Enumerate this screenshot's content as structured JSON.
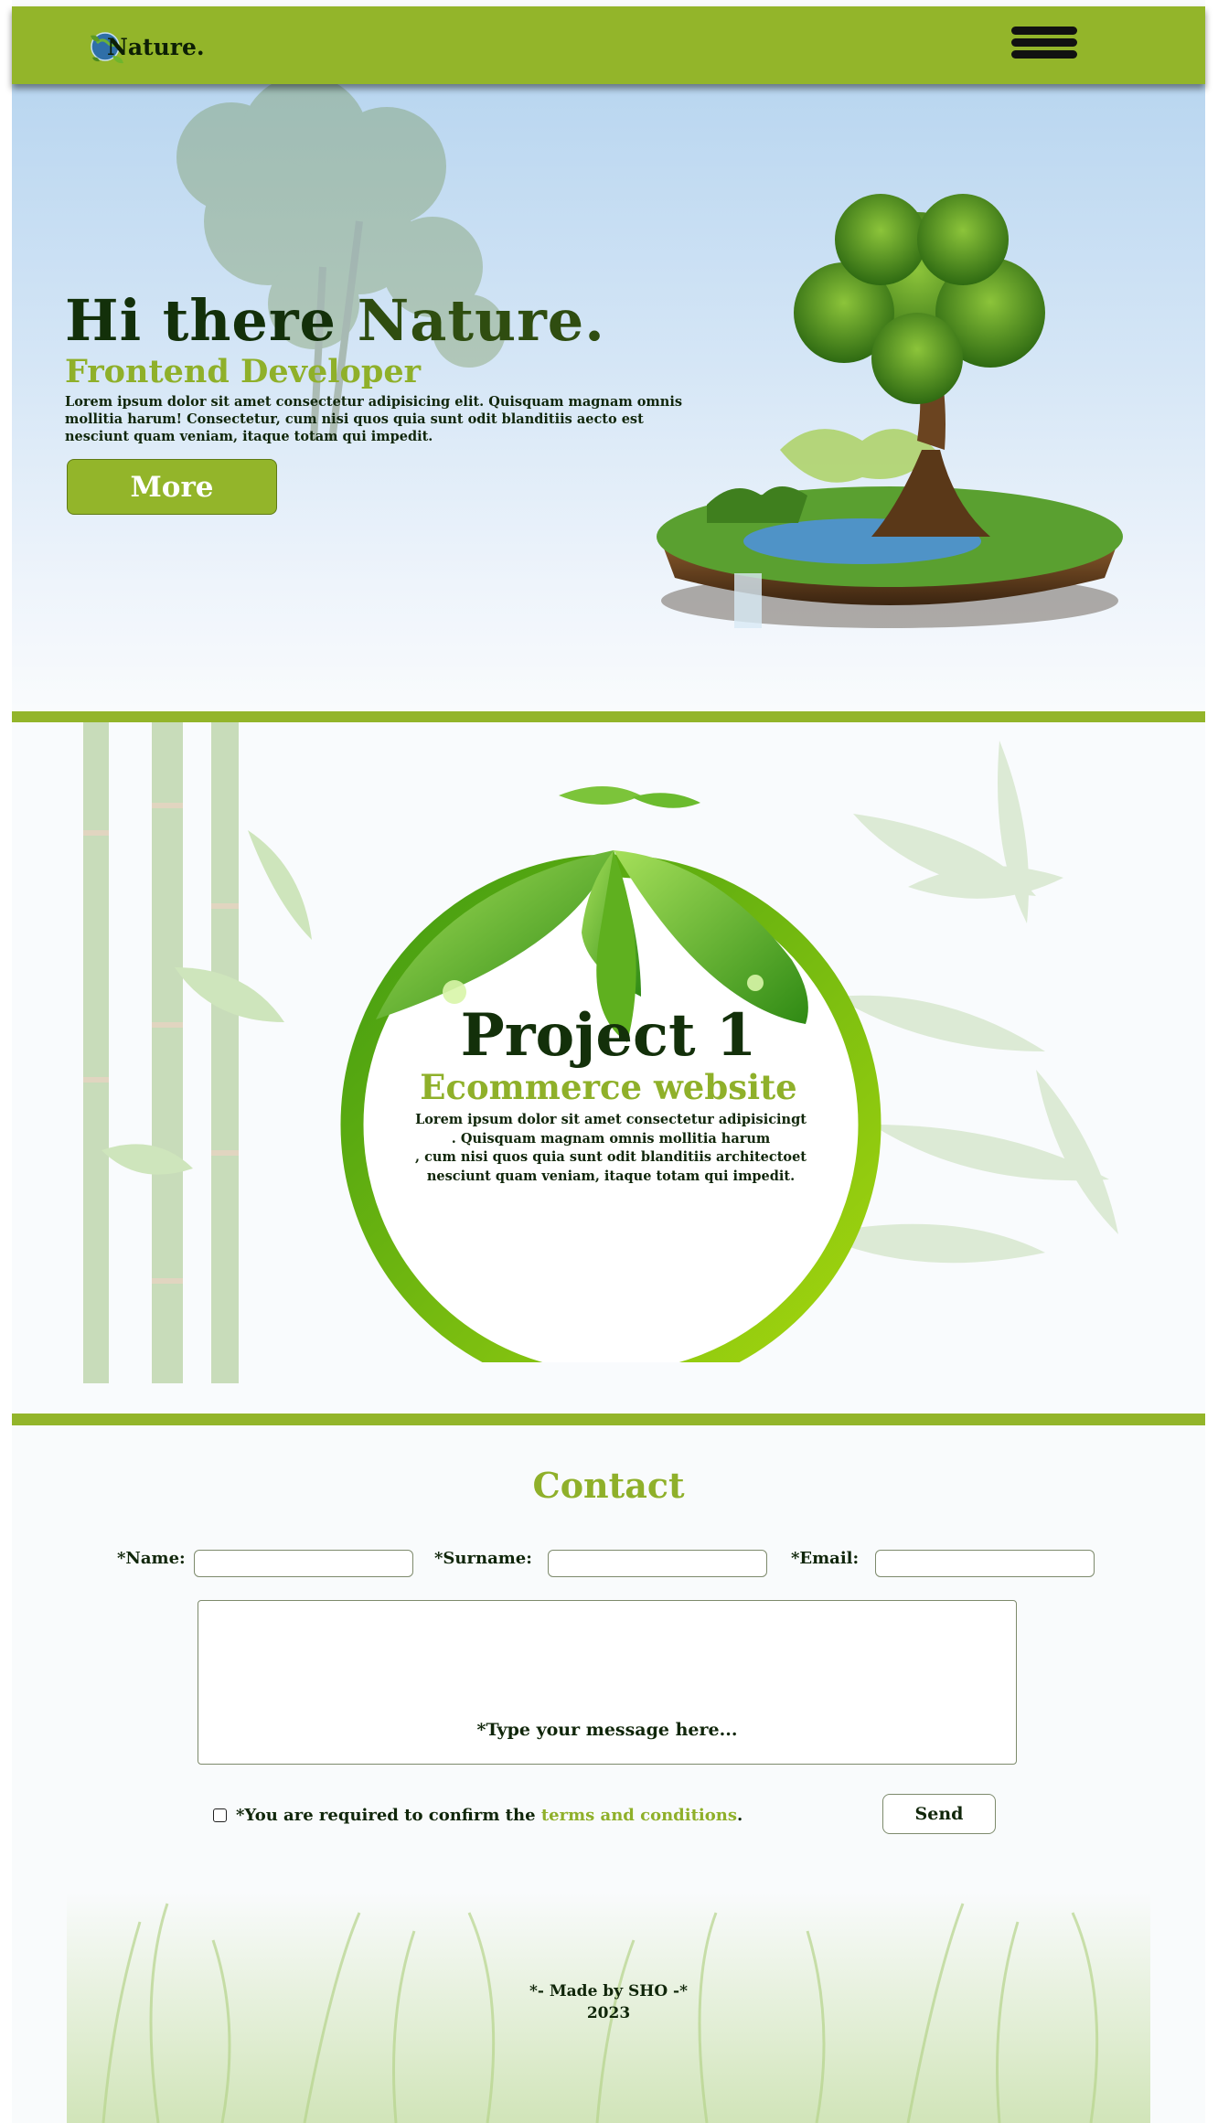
{
  "header": {
    "logo_text": "Nature.",
    "menu_icon": "hamburger-menu-icon"
  },
  "hero": {
    "title_part1": "Hi there ",
    "title_part2": "Nature.",
    "subtitle": "Frontend Developer",
    "text": "Lorem ipsum dolor sit amet consectetur adipisicing elit. Quisquam magnam omnis mollitia harum! Consectetur, cum nisi quos quia sunt odit blanditiis aecto est nesciunt quam veniam, itaque totam qui impedit.",
    "button_label": "More"
  },
  "project": {
    "title": "Project 1",
    "subtitle": "Ecommerce website",
    "text_lines": [
      "Lorem ipsum dolor sit amet consectetur adipisicingt",
      ". Quisquam magnam omnis mollitia harum",
      ", cum nisi quos quia sunt odit blanditiis architectoet",
      "nesciunt quam veniam, itaque totam qui impedit."
    ]
  },
  "contact": {
    "title": "Contact",
    "name_label": "*Name:",
    "surname_label": "*Surname:",
    "email_label": "*Email:",
    "name_value": "",
    "surname_value": "",
    "email_value": "",
    "message_placeholder": "*Type your message here...",
    "terms_prefix": "*You are required to confirm the ",
    "terms_link": "terms and conditions",
    "terms_suffix": ".",
    "send_label": "Send"
  },
  "footer": {
    "line1": "*- Made by SHO -*",
    "line2": "2023"
  },
  "colors": {
    "accent": "#93b52a",
    "dark_text": "#10260a",
    "sky": "#b9d6f0"
  }
}
